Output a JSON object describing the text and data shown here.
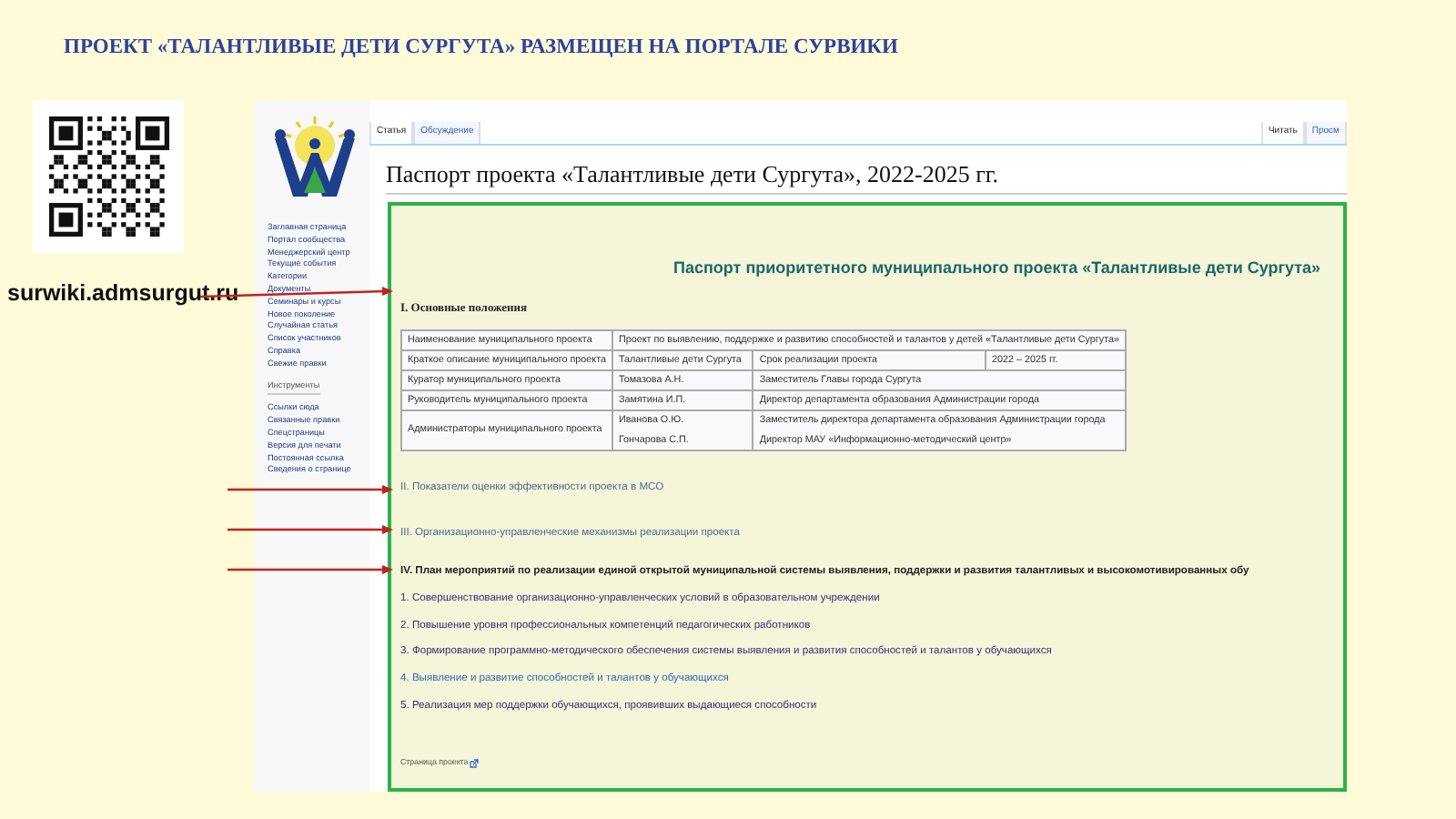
{
  "slide_title": "ПРОЕКТ «ТАЛАНТЛИВЫЕ ДЕТИ СУРГУТА» РАЗМЕЩЕН НА ПОРТАЛЕ СУРВИКИ",
  "site_url": "surwiki.admsurgut.ru",
  "wiki": {
    "navigation": [
      "Заглавная страница",
      "Портал сообщества",
      "Менеджерский центр",
      "Текущие события",
      "Категории",
      "Документы",
      "Семинары и курсы",
      "Новое поколение",
      "Случайная статья",
      "Список участников",
      "Справка",
      "Свежие правки"
    ],
    "tools_heading": "Инструменты",
    "tools": [
      "Ссылки сюда",
      "Связанные правки",
      "Спецстраницы",
      "Версия для печати",
      "Постоянная ссылка",
      "Сведения о странице"
    ],
    "tabs_left": [
      {
        "label": "Статья",
        "selected": true
      },
      {
        "label": "Обсуждение",
        "selected": false
      }
    ],
    "tabs_right": [
      {
        "label": "Читать",
        "selected": true
      },
      {
        "label": "Просм",
        "selected": false
      }
    ],
    "page_title": "Паспорт проекта «Талантливые дети Сургута», 2022-2025 гг.",
    "passport": {
      "title": "Паспорт приоритетного муниципального проекта «Талантливые дети Сургута»",
      "section_heading": "I. Основные положения",
      "table": [
        [
          {
            "lines": [
              "Наименование муниципального проекта"
            ]
          },
          {
            "lines": [
              "Проект по выявлению, поддержке и развитию способностей и талантов у детей «Талантливые дети Сургута»"
            ]
          }
        ],
        [
          {
            "lines": [
              "Краткое описание муниципального проекта"
            ]
          },
          {
            "lines": [
              "Талантливые дети Сургута"
            ]
          },
          {
            "lines": [
              "Срок реализации проекта"
            ]
          },
          {
            "lines": [
              "2022 – 2025 гг."
            ]
          }
        ],
        [
          {
            "lines": [
              "Куратор муниципального проекта"
            ]
          },
          {
            "lines": [
              "Томазова А.Н."
            ]
          },
          {
            "lines": [
              "Заместитель Главы города Сургута"
            ]
          }
        ],
        [
          {
            "lines": [
              "Руководитель муниципального проекта"
            ]
          },
          {
            "lines": [
              "Замятина И.П."
            ]
          },
          {
            "lines": [
              "Директор департамента образования Администрации города"
            ]
          }
        ],
        [
          {
            "lines": [
              "Администраторы муниципального проекта"
            ]
          },
          {
            "lines": [
              "Иванова О.Ю.",
              "Гончарова С.П."
            ]
          },
          {
            "lines": [
              "Заместитель директора департамента образования Администрации города",
              "Директор МАУ «Информационно-методический центр»"
            ]
          }
        ]
      ],
      "sections": [
        {
          "kind": "link",
          "text": "II. Показатели оценки эффективности проекта в МСО"
        },
        {
          "kind": "link",
          "text": "III. Организационно-управленческие механизмы реализации проекта"
        },
        {
          "kind": "heading",
          "text": "IV. План мероприятий по реализации единой открытой муниципальной системы выявления, поддержки и развития талантливых и высокомотивированных обу"
        },
        {
          "kind": "item",
          "visited": true,
          "text": "1. Совершенствование организационно-управленческих условий в образовательном учреждении"
        },
        {
          "kind": "item",
          "visited": true,
          "text": "2. Повышение уровня профессиональных компетенций педагогических работников"
        },
        {
          "kind": "item",
          "visited": true,
          "text": "3. Формирование программно-методического обеспечения системы выявления и развития способностей и талантов у обучающихся"
        },
        {
          "kind": "item",
          "visited": false,
          "text": "4. Выявление и развитие способностей и талантов у обучающихся"
        },
        {
          "kind": "item",
          "visited": true,
          "text": "5. Реализация мер поддержки обучающихся, проявивших выдающиеся способности"
        }
      ],
      "footer_link": "Страница проекта"
    }
  }
}
